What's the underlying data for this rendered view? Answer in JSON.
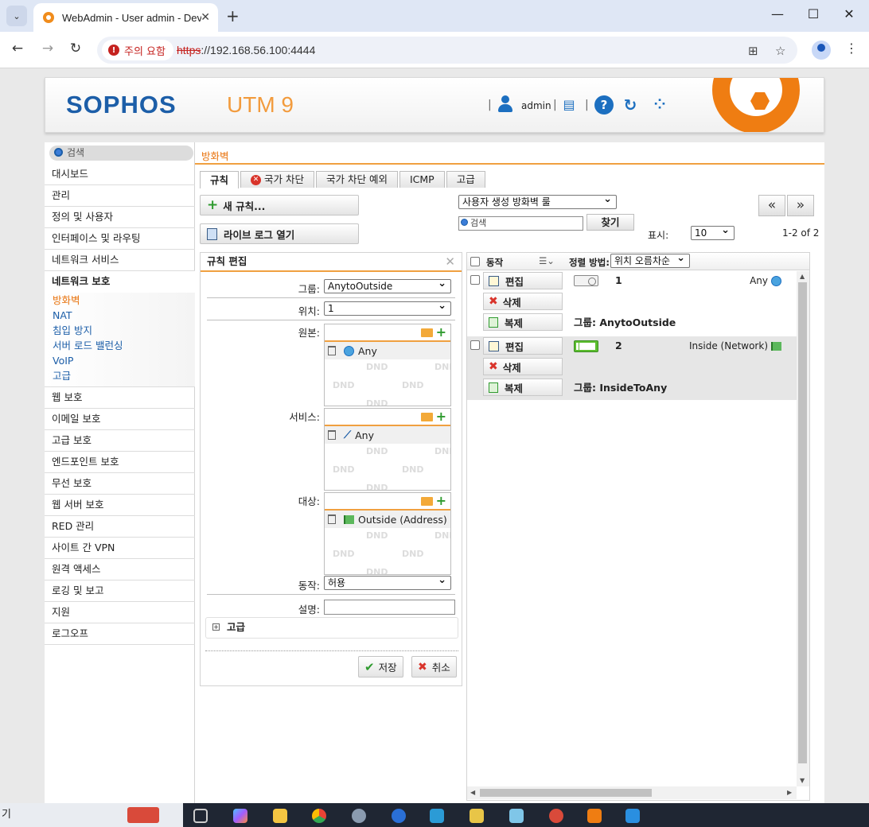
{
  "browser": {
    "tab_title": "WebAdmin - User admin - Dev",
    "security_chip": "주의 요함",
    "url_scheme": "https",
    "url_rest": "://192.168.56.100:4444"
  },
  "header": {
    "logo": "SOPHOS",
    "product": "UTM 9",
    "username": "admin",
    "help_glyph": "?",
    "reload_glyph": "↻"
  },
  "sidebar": {
    "search_placeholder": "검색",
    "items_top": [
      "대시보드",
      "관리",
      "정의 및 사용자",
      "인터페이스 및 라우팅",
      "네트워크 서비스"
    ],
    "active_item": "네트워크 보호",
    "sub_items": [
      "방화벽",
      "NAT",
      "침입 방지",
      "서버 로드 밸런싱",
      "VoIP",
      "고급"
    ],
    "items_bottom": [
      "웹 보호",
      "이메일 보호",
      "고급 보호",
      "엔드포인트 보호",
      "무선 보호",
      "웹 서버 보호",
      "RED 관리",
      "사이트 간 VPN",
      "원격 액세스",
      "로깅 및 보고",
      "지원",
      "로그오프"
    ]
  },
  "content": {
    "breadcrumb": "방화벽",
    "tabs": [
      "규칙",
      "국가 차단",
      "국가 차단 예외",
      "ICMP",
      "고급"
    ],
    "new_rule_button": "새 규칙...",
    "live_log_button": "라이브 로그 열기",
    "filter_select": "사용자 생성 방화벽 룰",
    "search_placeholder": "검색",
    "find_button": "찾기",
    "page_prev": "«",
    "page_next": "»",
    "display_label": "표시:",
    "display_count": "10",
    "range_text": "1-2 of 2"
  },
  "edit_panel": {
    "title": "규칙 편집",
    "group_label": "그룹:",
    "group_value": "AnytoOutside",
    "position_label": "위치:",
    "position_value": "1",
    "source_label": "원본:",
    "source_item": "Any",
    "service_label": "서비스:",
    "service_item": "Any",
    "dest_label": "대상:",
    "dest_item": "Outside (Address)",
    "action_label": "동작:",
    "action_value": "허용",
    "desc_label": "설명:",
    "advanced_label": "고급",
    "save_button": "저장",
    "cancel_button": "취소",
    "dnd_text": "DND"
  },
  "rules_list": {
    "action_header": "동작",
    "sort_label": "정렬 방법:",
    "sort_value": "위치 오름차순",
    "edit_label": "편집",
    "delete_label": "삭제",
    "copy_label": "복제",
    "rules": [
      {
        "num": "1",
        "source": "Any",
        "group": "그룹: AnytoOutside",
        "enabled": false
      },
      {
        "num": "2",
        "source": "Inside (Network)",
        "group": "그룹: InsideToAny",
        "enabled": true
      }
    ]
  },
  "taskbar": {
    "left_text": "기"
  },
  "colors": {
    "brand_blue": "#1c5ea8",
    "accent_orange": "#e8730d",
    "sophos_orange": "#ef7d12",
    "enabled_green": "#5bbd2e",
    "warning_red": "#c5221f"
  }
}
